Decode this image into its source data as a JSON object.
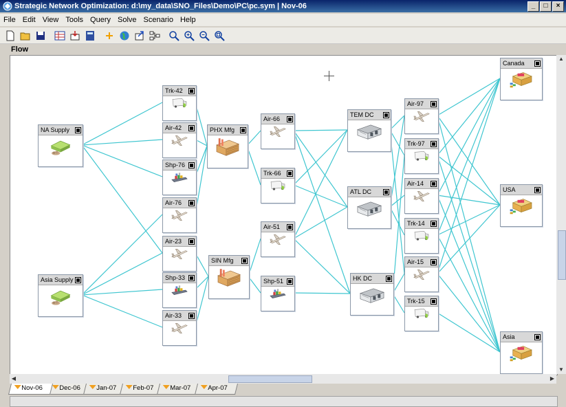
{
  "window": {
    "title": "Strategic Network Optimization:  d:\\my_data\\SNO_Files\\Demo\\PC\\pc.sym | Nov-06"
  },
  "menu": [
    "File",
    "Edit",
    "View",
    "Tools",
    "Query",
    "Solve",
    "Scenario",
    "Help"
  ],
  "toolbar": [
    "new-icon",
    "open-icon",
    "save-icon",
    "grid-icon",
    "import-icon",
    "calculator-icon",
    "arrow-icon",
    "globe-icon",
    "export-icon",
    "layout-icon",
    "zoom-icon",
    "zoom-in-icon",
    "zoom-out-icon",
    "zoom-fit-icon"
  ],
  "view_label": "Flow",
  "periods": [
    "Nov-06",
    "Dec-06",
    "Jan-07",
    "Feb-07",
    "Mar-07",
    "Apr-07"
  ],
  "active_period": "Nov-06",
  "colors": {
    "link": "#3fc6d0",
    "titlebar": "#0a246a",
    "node_border": "#8c98a8"
  },
  "nodes": [
    {
      "id": "na-supply",
      "label": "NA Supply",
      "type": "supply"
    },
    {
      "id": "asia-supply",
      "label": "Asia Supply",
      "type": "supply"
    },
    {
      "id": "trk-42",
      "label": "Trk-42",
      "type": "truck"
    },
    {
      "id": "air-42",
      "label": "Air-42",
      "type": "air"
    },
    {
      "id": "shp-76",
      "label": "Shp-76",
      "type": "ship"
    },
    {
      "id": "air-76",
      "label": "Air-76",
      "type": "air"
    },
    {
      "id": "air-23",
      "label": "Air-23",
      "type": "air"
    },
    {
      "id": "shp-33",
      "label": "Shp-33",
      "type": "ship"
    },
    {
      "id": "air-33",
      "label": "Air-33",
      "type": "air"
    },
    {
      "id": "phx-mfg",
      "label": "PHX Mfg",
      "type": "factory"
    },
    {
      "id": "sin-mfg",
      "label": "SIN Mfg",
      "type": "factory"
    },
    {
      "id": "air-66",
      "label": "Air-66",
      "type": "air"
    },
    {
      "id": "trk-66",
      "label": "Trk-66",
      "type": "truck"
    },
    {
      "id": "air-51",
      "label": "Air-51",
      "type": "air"
    },
    {
      "id": "shp-51",
      "label": "Shp-51",
      "type": "ship"
    },
    {
      "id": "tem-dc",
      "label": "TEM DC",
      "type": "dc"
    },
    {
      "id": "atl-dc",
      "label": "ATL DC",
      "type": "dc"
    },
    {
      "id": "hk-dc",
      "label": "HK DC",
      "type": "dc"
    },
    {
      "id": "air-97",
      "label": "Air-97",
      "type": "air"
    },
    {
      "id": "trk-97",
      "label": "Trk-97",
      "type": "truck"
    },
    {
      "id": "air-14",
      "label": "Air-14",
      "type": "air"
    },
    {
      "id": "trk-14",
      "label": "Trk-14",
      "type": "truck"
    },
    {
      "id": "air-15",
      "label": "Air-15",
      "type": "air"
    },
    {
      "id": "trk-15",
      "label": "Trk-15",
      "type": "truck"
    },
    {
      "id": "canada",
      "label": "Canada",
      "type": "market"
    },
    {
      "id": "usa",
      "label": "USA",
      "type": "market"
    },
    {
      "id": "asia",
      "label": "Asia",
      "type": "market"
    }
  ],
  "links": [
    [
      "na-supply",
      "trk-42"
    ],
    [
      "na-supply",
      "air-42"
    ],
    [
      "na-supply",
      "shp-76"
    ],
    [
      "na-supply",
      "air-23"
    ],
    [
      "asia-supply",
      "air-76"
    ],
    [
      "asia-supply",
      "air-23"
    ],
    [
      "asia-supply",
      "shp-33"
    ],
    [
      "asia-supply",
      "air-33"
    ],
    [
      "trk-42",
      "phx-mfg"
    ],
    [
      "air-42",
      "phx-mfg"
    ],
    [
      "shp-76",
      "phx-mfg"
    ],
    [
      "air-76",
      "phx-mfg"
    ],
    [
      "air-23",
      "sin-mfg"
    ],
    [
      "shp-33",
      "sin-mfg"
    ],
    [
      "air-33",
      "sin-mfg"
    ],
    [
      "phx-mfg",
      "air-66"
    ],
    [
      "phx-mfg",
      "trk-66"
    ],
    [
      "sin-mfg",
      "air-51"
    ],
    [
      "sin-mfg",
      "shp-51"
    ],
    [
      "air-66",
      "tem-dc"
    ],
    [
      "air-66",
      "atl-dc"
    ],
    [
      "air-66",
      "hk-dc"
    ],
    [
      "trk-66",
      "tem-dc"
    ],
    [
      "trk-66",
      "atl-dc"
    ],
    [
      "air-51",
      "tem-dc"
    ],
    [
      "air-51",
      "atl-dc"
    ],
    [
      "air-51",
      "hk-dc"
    ],
    [
      "shp-51",
      "hk-dc"
    ],
    [
      "tem-dc",
      "air-97"
    ],
    [
      "tem-dc",
      "trk-97"
    ],
    [
      "tem-dc",
      "air-15"
    ],
    [
      "atl-dc",
      "air-14"
    ],
    [
      "atl-dc",
      "trk-14"
    ],
    [
      "atl-dc",
      "air-97"
    ],
    [
      "hk-dc",
      "air-15"
    ],
    [
      "hk-dc",
      "trk-15"
    ],
    [
      "hk-dc",
      "trk-97"
    ],
    [
      "air-97",
      "canada"
    ],
    [
      "air-97",
      "usa"
    ],
    [
      "air-97",
      "asia"
    ],
    [
      "trk-97",
      "canada"
    ],
    [
      "trk-97",
      "usa"
    ],
    [
      "trk-97",
      "asia"
    ],
    [
      "air-14",
      "canada"
    ],
    [
      "air-14",
      "usa"
    ],
    [
      "air-14",
      "asia"
    ],
    [
      "trk-14",
      "canada"
    ],
    [
      "trk-14",
      "usa"
    ],
    [
      "trk-14",
      "asia"
    ],
    [
      "air-15",
      "canada"
    ],
    [
      "air-15",
      "usa"
    ],
    [
      "air-15",
      "asia"
    ],
    [
      "trk-15",
      "asia"
    ]
  ]
}
